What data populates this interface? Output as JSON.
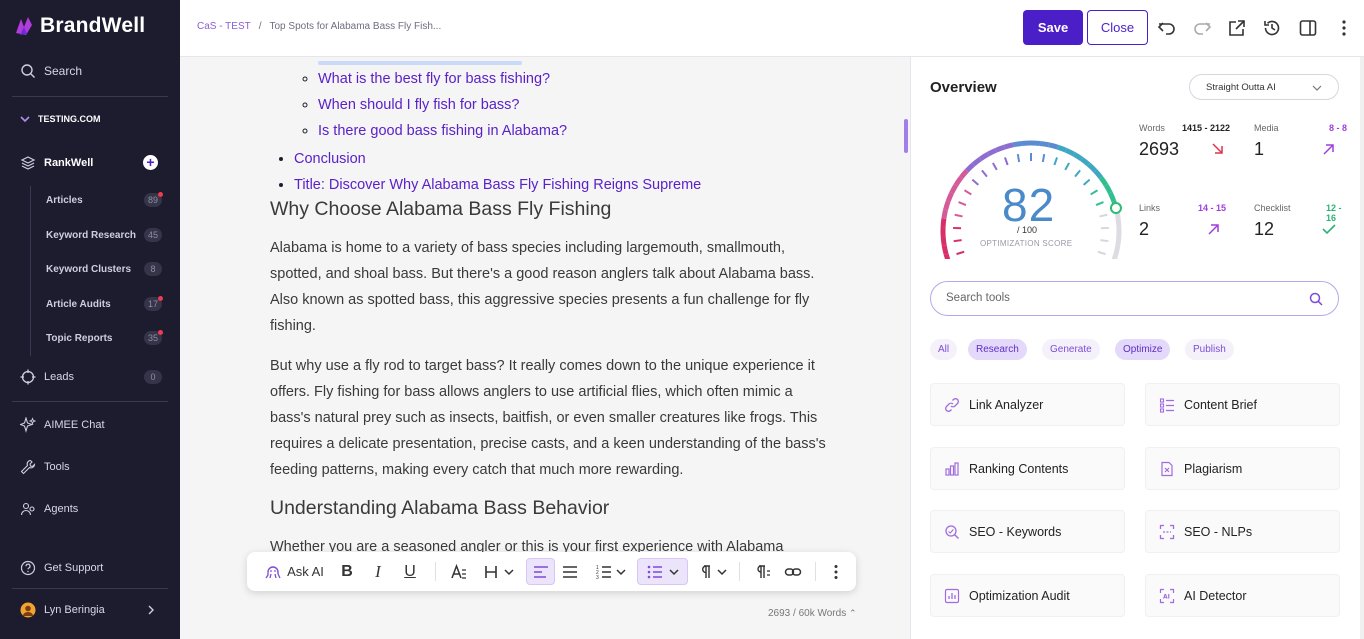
{
  "sidebar": {
    "brand": "BrandWell",
    "search": "Search",
    "workspace": "TESTING.COM",
    "rankwell": "RankWell",
    "items": [
      {
        "label": "Articles",
        "count": "89",
        "dot": true
      },
      {
        "label": "Keyword Research",
        "count": "45",
        "dot": false
      },
      {
        "label": "Keyword Clusters",
        "count": "8",
        "dot": false
      },
      {
        "label": "Article Audits",
        "count": "17",
        "dot": true
      },
      {
        "label": "Topic Reports",
        "count": "35",
        "dot": true
      }
    ],
    "leads": "Leads",
    "leads_count": "0",
    "aimee": "AIMEE Chat",
    "tools": "Tools",
    "agents": "Agents",
    "support": "Get Support",
    "user": "Lyn Beringia"
  },
  "topbar": {
    "crumb_root": "CaS - TEST",
    "crumb_sep": "/",
    "crumb_page": "Top Spots for Alabama Bass Fly Fish...",
    "save": "Save",
    "close": "Close"
  },
  "editor": {
    "toc_sub": [
      "What is the best fly for bass fishing?",
      "When should I fly fish for bass?",
      "Is there good bass fishing in Alabama?"
    ],
    "toc_top": [
      "Conclusion",
      "Title: Discover Why Alabama Bass Fly Fishing Reigns Supreme"
    ],
    "h2_1": "Why Choose Alabama Bass Fly Fishing",
    "p1": "Alabama is home to a variety of bass species including largemouth, smallmouth, spotted, and shoal bass. But there's a good reason anglers talk about Alabama bass. Also known as spotted bass, this aggressive species presents a fun challenge for fly fishing.",
    "p2": "But why use a fly rod to target bass? It really comes down to the unique experience it offers. Fly fishing for bass allows anglers to use artificial flies, which often mimic a bass's natural prey such as insects, baitfish, or even smaller creatures like frogs. This requires a delicate presentation, precise casts, and a keen understanding of the bass's feeding patterns, making every catch that much more rewarding.",
    "h2_2": "Understanding Alabama Bass Behavior",
    "p3": "Whether you are a seasoned angler or this is your first experience with Alabama",
    "ask_ai": "Ask AI",
    "word_count": "2693 / 60k Words"
  },
  "overview": {
    "title": "Overview",
    "mode": "Straight Outta AI",
    "score": "82",
    "score_denom": "/ 100",
    "score_label": "OPTIMIZATION SCORE",
    "score_fraction": 0.82,
    "metrics": {
      "words": {
        "label": "Words",
        "range": "1415 - 2122",
        "value": "2693",
        "trend": "down",
        "color": "#e0314f"
      },
      "media": {
        "label": "Media",
        "range": "8 - 8",
        "value": "1",
        "trend": "up",
        "color": "#a23ddc"
      },
      "links": {
        "label": "Links",
        "range": "14 - 15",
        "value": "2",
        "trend": "up",
        "color": "#a23ddc"
      },
      "checklist": {
        "label": "Checklist",
        "range": "12 - 16",
        "value": "12",
        "trend": "check",
        "color": "#2fb277"
      }
    },
    "search_placeholder": "Search tools",
    "chips": [
      "All",
      "Research",
      "Generate",
      "Optimize",
      "Publish"
    ],
    "tools": [
      {
        "label": "Link Analyzer",
        "icon": "link-icon"
      },
      {
        "label": "Content Brief",
        "icon": "list-icon"
      },
      {
        "label": "Ranking Contents",
        "icon": "bar-chart-icon"
      },
      {
        "label": "Plagiarism",
        "icon": "document-x-icon"
      },
      {
        "label": "SEO - Keywords",
        "icon": "search-keyword-icon"
      },
      {
        "label": "SEO - NLPs",
        "icon": "scan-icon"
      },
      {
        "label": "Optimization Audit",
        "icon": "audit-icon"
      },
      {
        "label": "AI Detector",
        "icon": "ai-detector-icon"
      }
    ]
  },
  "colors": {
    "brand": "#4b1fc8",
    "sidebar_bg": "#1d1b2e",
    "link": "#5b21c9"
  }
}
